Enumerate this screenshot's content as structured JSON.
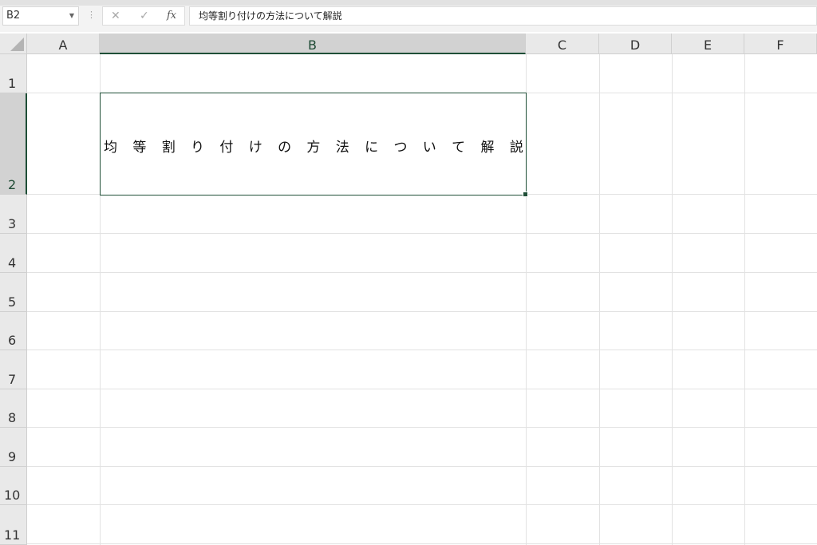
{
  "formula_bar": {
    "name_box": "B2",
    "cancel_icon": "✕",
    "enter_icon": "✓",
    "fx_label": "fx",
    "formula": "均等割り付けの方法について解説"
  },
  "columns": [
    "A",
    "B",
    "C",
    "D",
    "E",
    "F"
  ],
  "rows": [
    "1",
    "2",
    "3",
    "4",
    "5",
    "6",
    "7",
    "8",
    "9",
    "10",
    "11"
  ],
  "selection": {
    "cell": "B2",
    "column": "B",
    "row": "2"
  },
  "cells": {
    "B2": "均等割り付けの方法について解説",
    "B2_chars": [
      "均",
      "等",
      "割",
      "り",
      "付",
      "け",
      "の",
      "方",
      "法",
      "に",
      "つ",
      "い",
      "て",
      "解",
      "説"
    ]
  },
  "colors": {
    "selection": "#1f4f37",
    "header_bg": "#e9e9e9",
    "header_selected_bg": "#d2d2d2"
  }
}
